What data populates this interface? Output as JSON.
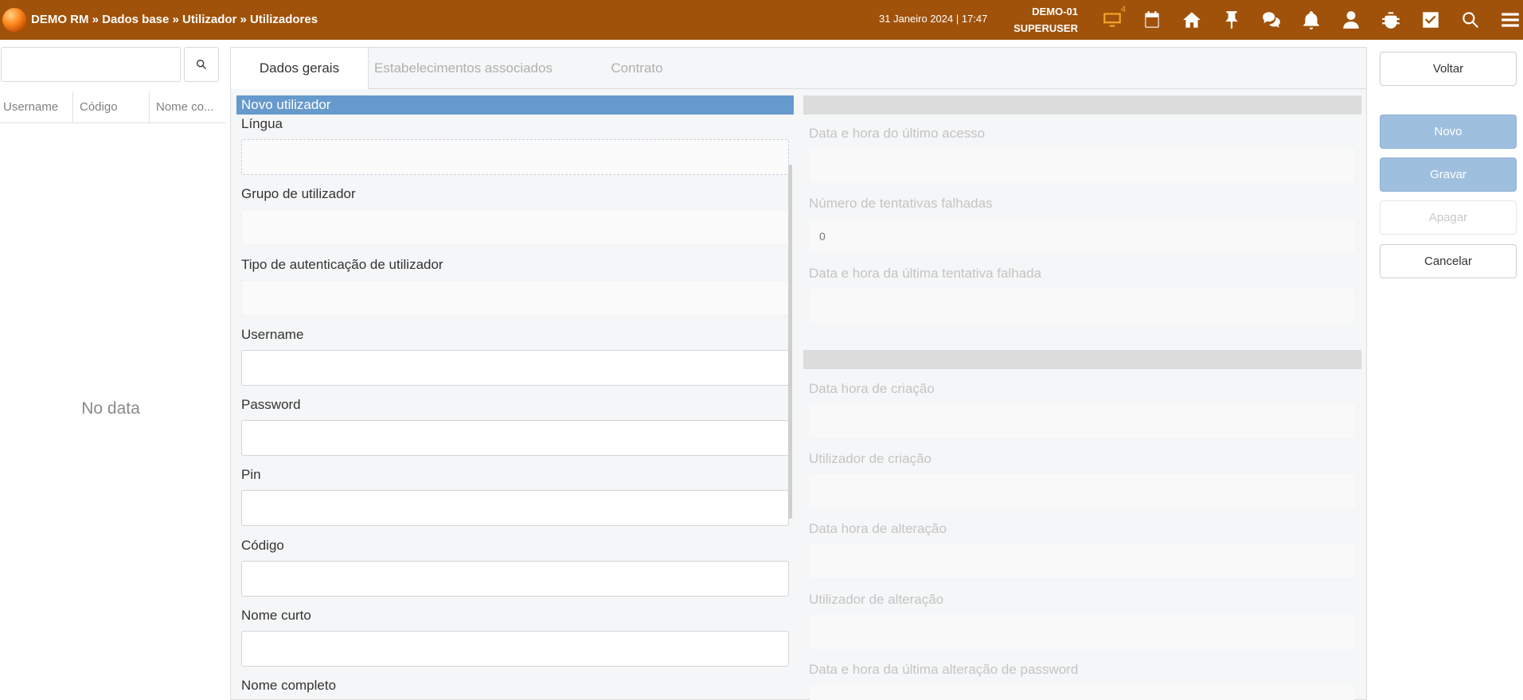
{
  "header": {
    "breadcrumb": "DEMO RM » Dados base » Utilizador » Utilizadores",
    "datetime": "31 Janeiro 2024 | 17:47",
    "company": "DEMO-01",
    "user": "SUPERUSER",
    "notification_count": "4",
    "icons": [
      "monitor-icon",
      "calendar-icon",
      "home-icon",
      "pin-icon",
      "chat-icon",
      "bell-icon",
      "user-icon",
      "bug-icon",
      "checkbox-icon",
      "search-icon",
      "menu-icon"
    ]
  },
  "left": {
    "search_placeholder": "",
    "columns": [
      "Username",
      "Código",
      "Nome co..."
    ],
    "empty_text": "No data"
  },
  "tabs": [
    {
      "label": "Dados gerais",
      "active": true
    },
    {
      "label": "Estabelecimentos associados",
      "active": false
    },
    {
      "label": "Contrato",
      "active": false
    }
  ],
  "form": {
    "section_title": "Novo utilizador",
    "fields": [
      {
        "label": "Língua",
        "value": ""
      },
      {
        "label": "Grupo de utilizador",
        "value": ""
      },
      {
        "label": "Tipo de autenticação de utilizador",
        "value": ""
      },
      {
        "label": "Username",
        "value": ""
      },
      {
        "label": "Password",
        "value": ""
      },
      {
        "label": "Pin",
        "value": ""
      },
      {
        "label": "Código",
        "value": ""
      },
      {
        "label": "Nome curto",
        "value": ""
      },
      {
        "label": "Nome completo",
        "value": ""
      }
    ]
  },
  "info": {
    "access": [
      {
        "label": "Data e hora do último acesso",
        "value": ""
      },
      {
        "label": "Número de tentativas falhadas",
        "value": "0"
      },
      {
        "label": "Data e hora da última tentativa falhada",
        "value": ""
      }
    ],
    "audit": [
      {
        "label": "Data hora de criação",
        "value": ""
      },
      {
        "label": "Utilizador de criação",
        "value": ""
      },
      {
        "label": "Data hora de alteração",
        "value": ""
      },
      {
        "label": "Utilizador de alteração",
        "value": ""
      },
      {
        "label": "Data e hora da última alteração de password",
        "value": ""
      }
    ]
  },
  "actions": {
    "back": "Voltar",
    "new": "Novo",
    "save": "Gravar",
    "delete": "Apagar",
    "cancel": "Cancelar"
  },
  "colors": {
    "topbar": "#a0520a",
    "section_header": "#6699cc",
    "primary_button": "#9fbfdf",
    "badge": "#f4a52b"
  }
}
